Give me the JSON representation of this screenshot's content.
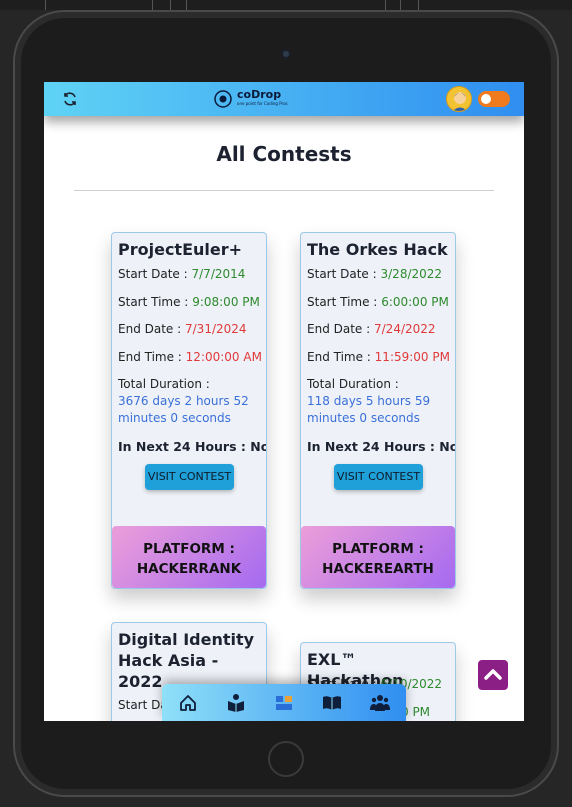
{
  "page": {
    "title": "All Contests"
  },
  "header": {
    "logo_text": "coDrop",
    "logo_tagline": "one point for Coding Pros"
  },
  "contests": [
    {
      "name": "ProjectEuler+",
      "start_date_label": "Start Date :",
      "start_date": "7/7/2014",
      "start_time_label": "Start Time :",
      "start_time": "9:08:00 PM",
      "end_date_label": "End Date :",
      "end_date": "7/31/2024",
      "end_time_label": "End Time :",
      "end_time": "12:00:00 AM",
      "duration_label": "Total Duration :",
      "duration": "3676 days 2 hours 52 minutes 0 seconds",
      "next24": "In Next 24 Hours : No",
      "visit_label": "VISIT CONTEST",
      "platform": "PLATFORM : HACKERRANK"
    },
    {
      "name": "The Orkes Hack",
      "start_date_label": "Start Date :",
      "start_date": "3/28/2022",
      "start_time_label": "Start Time :",
      "start_time": "6:00:00 PM",
      "end_date_label": "End Date :",
      "end_date": "7/24/2022",
      "end_time_label": "End Time :",
      "end_time": "11:59:00 PM",
      "duration_label": "Total Duration :",
      "duration": "118 days 5 hours 59 minutes 0 seconds",
      "next24": "In Next 24 Hours : No",
      "visit_label": "VISIT CONTEST",
      "platform": "PLATFORM : HACKEREARTH"
    },
    {
      "name": "Digital Identity Hack Asia - 2022",
      "start_date_label": "Start Date :"
    },
    {
      "name": "EXL™ Hackathon",
      "start_date_label": "Start Date :",
      "start_date": "6/10/2022",
      "start_time_visible": "0 PM"
    }
  ],
  "colors": {
    "nav_gradient_start": "#5fd3f5",
    "nav_gradient_end": "#2f8ef0",
    "date_green": "#2d8a2d",
    "date_red": "#e03a3a",
    "duration_blue": "#3a6fd8",
    "visit_button": "#1fa0d8",
    "platform_gradient_start": "#ec9ed9",
    "platform_gradient_end": "#a56af0",
    "scroll_top": "#8b1f86",
    "toggle": "#f07b1e"
  },
  "icons": {
    "refresh": "refresh-icon",
    "avatar": "user-avatar",
    "toggle": "theme-toggle",
    "bottom_nav": [
      "home-icon",
      "book-reader-icon",
      "contests-icon",
      "open-book-icon",
      "users-icon"
    ],
    "scroll_top": "chevron-up-icon"
  }
}
